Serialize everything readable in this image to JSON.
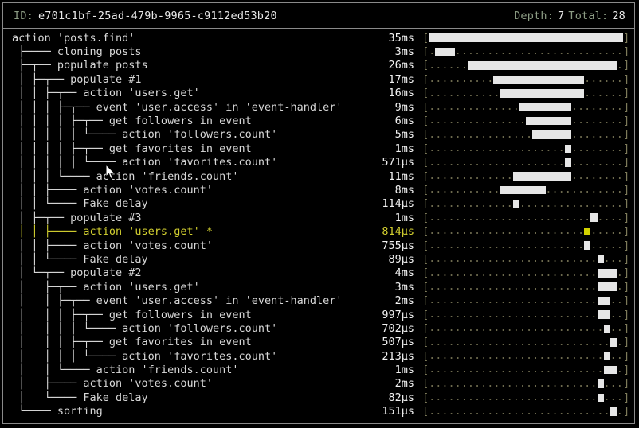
{
  "header": {
    "id_label": "ID:",
    "id_value": "e701c1bf-25ad-479b-9965-c9112ed53b20",
    "depth_label": "Depth:",
    "depth_value": "7",
    "total_label": "Total:",
    "total_value": "28"
  },
  "colors": {
    "background": "#000000",
    "border": "#8a8a8a",
    "label": "#8c9c84",
    "text": "#e8e8e8",
    "bar": "#e6e6e6",
    "dot": "#6d6a4e",
    "bracket": "#7d7a5a",
    "highlight": "#d2cf30",
    "highlight_bar": "#d2d200"
  },
  "gantt": {
    "open_bracket": "[",
    "close_bracket": "]",
    "dot": ".",
    "cells": 30
  },
  "rows": [
    {
      "tree": "action 'posts.find'",
      "duration": "35ms",
      "start": 0,
      "span": 30,
      "highlight": false
    },
    {
      "tree": " ├──── cloning posts",
      "duration": "3ms",
      "start": 1,
      "span": 3,
      "highlight": false
    },
    {
      "tree": " ├─┬── populate posts",
      "duration": "26ms",
      "start": 6,
      "span": 23,
      "highlight": false
    },
    {
      "tree": " │ ├─┬── populate #1",
      "duration": "17ms",
      "start": 10,
      "span": 14,
      "highlight": false
    },
    {
      "tree": " │ │ ├─┬── action 'users.get'",
      "duration": "16ms",
      "start": 11,
      "span": 13,
      "highlight": false
    },
    {
      "tree": " │ │ │ ├─┬── event 'user.access' in 'event-handler'",
      "duration": "9ms",
      "start": 14,
      "span": 8,
      "highlight": false
    },
    {
      "tree": " │ │ │ │ ├─┬── get followers in event",
      "duration": "6ms",
      "start": 15,
      "span": 7,
      "highlight": false
    },
    {
      "tree": " │ │ │ │ │ └──── action 'followers.count'",
      "duration": "5ms",
      "start": 16,
      "span": 6,
      "highlight": false
    },
    {
      "tree": " │ │ │ │ ├─┬── get favorites in event",
      "duration": "1ms",
      "start": 21,
      "span": 1,
      "highlight": false
    },
    {
      "tree": " │ │ │ │ │ └──── action 'favorites.count'",
      "duration": "571µs",
      "start": 21,
      "span": 1,
      "highlight": false
    },
    {
      "tree": " │ │ │ └──── action 'friends.count'",
      "duration": "11ms",
      "start": 13,
      "span": 9,
      "highlight": false
    },
    {
      "tree": " │ │ ├──── action 'votes.count'",
      "duration": "8ms",
      "start": 11,
      "span": 7,
      "highlight": false
    },
    {
      "tree": " │ │ └──── Fake delay",
      "duration": "114µs",
      "start": 13,
      "span": 1,
      "highlight": false
    },
    {
      "tree": " │ ├─┬── populate #3",
      "duration": "1ms",
      "start": 25,
      "span": 1,
      "highlight": false
    },
    {
      "tree": " │ │ ├──── action 'users.get' *",
      "duration": "814µs",
      "start": 24,
      "span": 1,
      "highlight": true
    },
    {
      "tree": " │ │ ├──── action 'votes.count'",
      "duration": "755µs",
      "start": 24,
      "span": 1,
      "highlight": false
    },
    {
      "tree": " │ │ └──── Fake delay",
      "duration": "89µs",
      "start": 26,
      "span": 1,
      "highlight": false
    },
    {
      "tree": " │ └─┬── populate #2",
      "duration": "4ms",
      "start": 26,
      "span": 3,
      "highlight": false
    },
    {
      "tree": " │   ├─┬── action 'users.get'",
      "duration": "3ms",
      "start": 26,
      "span": 3,
      "highlight": false
    },
    {
      "tree": " │   │ ├─┬── event 'user.access' in 'event-handler'",
      "duration": "2ms",
      "start": 26,
      "span": 2,
      "highlight": false
    },
    {
      "tree": " │   │ │ ├─┬── get followers in event",
      "duration": "997µs",
      "start": 26,
      "span": 2,
      "highlight": false
    },
    {
      "tree": " │   │ │ │ └──── action 'followers.count'",
      "duration": "702µs",
      "start": 27,
      "span": 1,
      "highlight": false
    },
    {
      "tree": " │   │ │ ├─┬── get favorites in event",
      "duration": "507µs",
      "start": 28,
      "span": 1,
      "highlight": false
    },
    {
      "tree": " │   │ │ │ └──── action 'favorites.count'",
      "duration": "213µs",
      "start": 27,
      "span": 1,
      "highlight": false
    },
    {
      "tree": " │   │ └──── action 'friends.count'",
      "duration": "1ms",
      "start": 27,
      "span": 2,
      "highlight": false
    },
    {
      "tree": " │   ├──── action 'votes.count'",
      "duration": "2ms",
      "start": 26,
      "span": 1,
      "highlight": false
    },
    {
      "tree": " │   └──── Fake delay",
      "duration": "82µs",
      "start": 26,
      "span": 1,
      "highlight": false
    },
    {
      "tree": " └──── sorting",
      "duration": "151µs",
      "start": 28,
      "span": 1,
      "highlight": false
    }
  ],
  "cursor": {
    "icon": "mouse-pointer"
  }
}
